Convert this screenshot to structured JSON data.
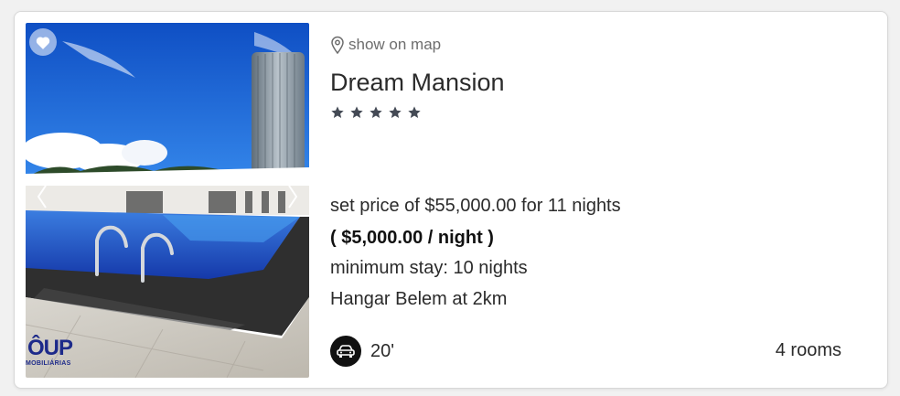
{
  "card": {
    "favorite_icon": "heart-icon",
    "map_link": {
      "icon": "map-pin-icon",
      "label": "show on map"
    },
    "title": "Dream Mansion",
    "stars": 5,
    "price_line": "set price of  $55,000.00 for 11 nights",
    "per_night": "( $5,000.00 / night )",
    "minimum_stay": "minimum stay: 10 nights",
    "distance": "Hangar Belem at 2km",
    "drive_icon": "car-icon",
    "drive_time": "20'",
    "rooms": "4 rooms",
    "photo_watermark": {
      "mark": "ÔUP",
      "sub": "MOBILIÁRIAS"
    }
  },
  "colors": {
    "sky": "#1f6fd6",
    "pool": "#1c56c8",
    "star": "#444a55",
    "watermark": "#1d2a8a"
  }
}
